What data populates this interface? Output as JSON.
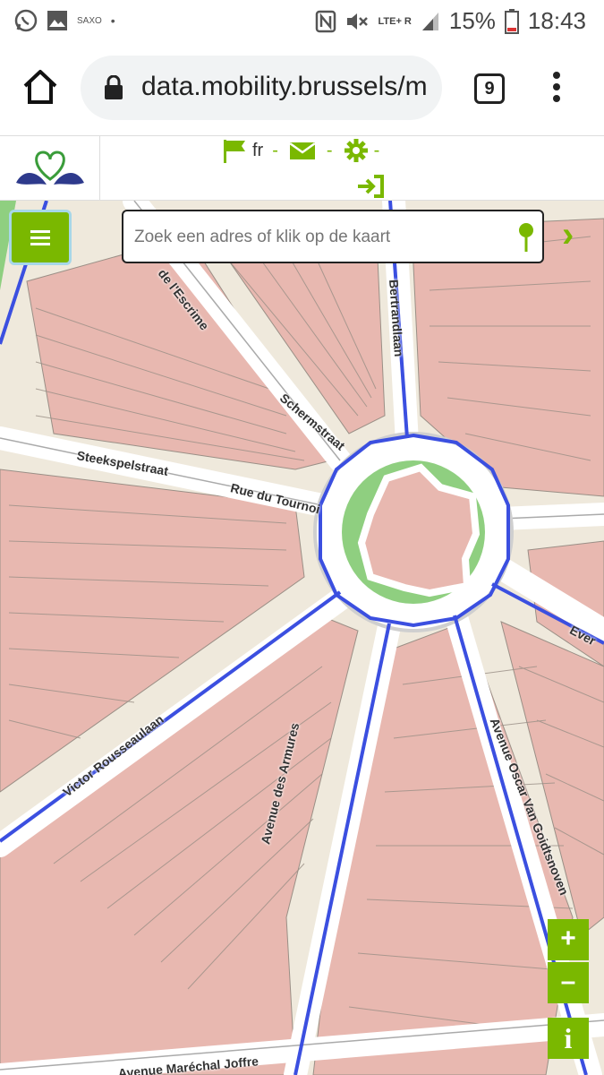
{
  "status_bar": {
    "carrier_label": "SAXO",
    "network": "LTE+ R",
    "battery": "15%",
    "time": "18:43"
  },
  "browser": {
    "url": "data.mobility.brussels/m",
    "tab_count": "9"
  },
  "header": {
    "language": "fr",
    "separator": "-"
  },
  "search": {
    "placeholder": "Zoek een adres of klik op de kaart"
  },
  "map": {
    "streets": [
      "de l'Escrime",
      "Schermstraat",
      "Steekspelstraat",
      "Rue du Tournoi",
      "Victor Rousseaulaan",
      "Avenue des Armures",
      "Avenue Oscar Van Goidtsnoven",
      "Avenue Maréchal Joffre",
      "Ever",
      "Bertrandlaan"
    ]
  },
  "controls": {
    "zoom_in": "+",
    "zoom_out": "–",
    "info": "i"
  },
  "colors": {
    "accent": "#7ab800",
    "route": "#3b4fe0",
    "building": "#e8b8b0",
    "park": "#8fcf80"
  }
}
